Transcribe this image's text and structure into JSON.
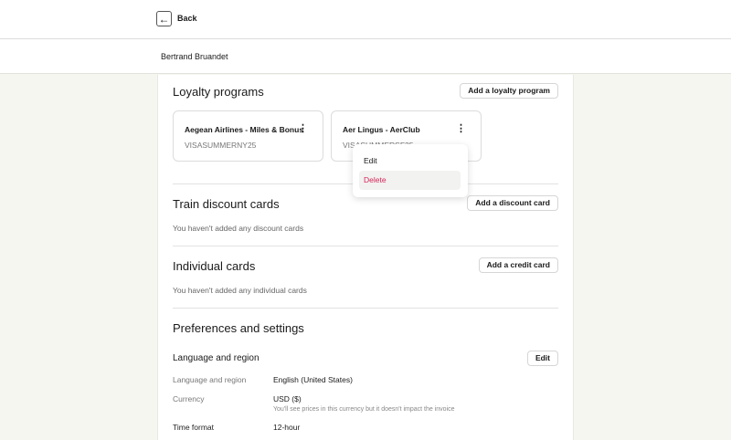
{
  "header": {
    "back_label": "Back"
  },
  "user": {
    "name": "Bertrand Bruandet"
  },
  "loyalty": {
    "title": "Loyalty programs",
    "add_label": "Add a loyalty program",
    "cards": [
      {
        "name": "Aegean Airlines - Miles & Bonus",
        "code": "VISASUMMERNY25"
      },
      {
        "name": "Aer Lingus - AerClub",
        "code": "VISASUMMERSF25"
      }
    ],
    "menu": {
      "edit": "Edit",
      "delete": "Delete"
    }
  },
  "train": {
    "title": "Train discount cards",
    "add_label": "Add a discount card",
    "empty": "You haven't added any discount cards"
  },
  "individual": {
    "title": "Individual cards",
    "add_label": "Add a credit card",
    "empty": "You haven't added any individual cards"
  },
  "prefs": {
    "title": "Preferences and settings",
    "section": "Language and region",
    "edit_label": "Edit",
    "rows": [
      {
        "label": "Language and region",
        "value": "English (United States)"
      },
      {
        "label": "Currency",
        "value": "USD ($)",
        "note": "You'll see prices in this currency but it doesn't impact the invoice"
      },
      {
        "label": "Time format",
        "value": "12-hour"
      }
    ]
  },
  "colors": {
    "danger": "#d6245a"
  }
}
